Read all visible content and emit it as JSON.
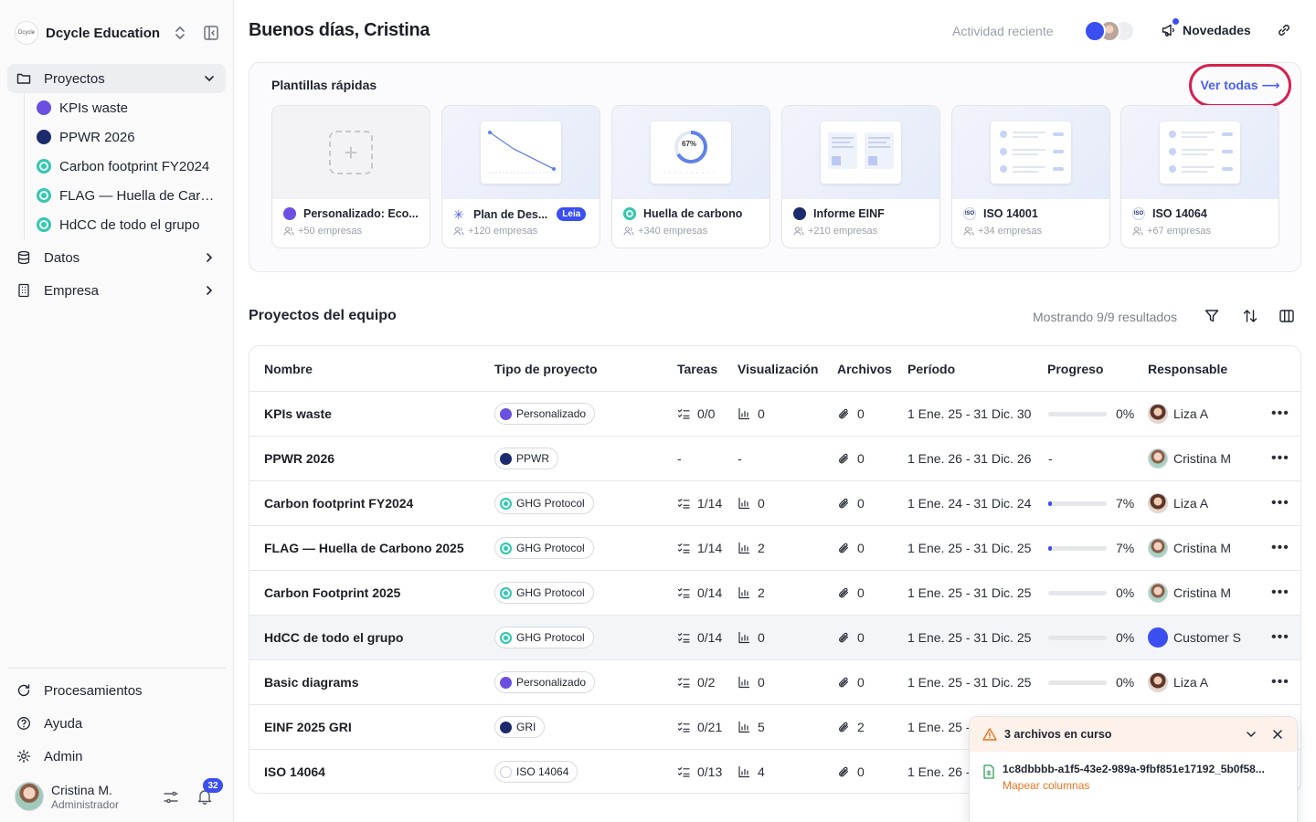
{
  "sidebar": {
    "org_name": "Dcycle Education",
    "org_logo_text": "Dcycle",
    "nav": [
      {
        "label": "Proyectos",
        "icon": "folder-icon"
      },
      {
        "label": "Datos",
        "icon": "database-icon"
      },
      {
        "label": "Empresa",
        "icon": "building-icon"
      }
    ],
    "projects": [
      {
        "label": "KPIs waste",
        "icon": "custom-icon"
      },
      {
        "label": "PPWR 2026",
        "icon": "eu-icon"
      },
      {
        "label": "Carbon footprint FY2024",
        "icon": "ghg-icon"
      },
      {
        "label": "FLAG — Huella de Carbono 2025",
        "icon": "ghg-icon"
      },
      {
        "label": "HdCC de todo el grupo",
        "icon": "ghg-icon"
      }
    ],
    "bottom": [
      {
        "label": "Procesamientos",
        "icon": "refresh-icon"
      },
      {
        "label": "Ayuda",
        "icon": "help-icon"
      },
      {
        "label": "Admin",
        "icon": "gear-icon"
      }
    ],
    "user": {
      "name": "Cristina M.",
      "role": "Administrador",
      "notifications": "32"
    }
  },
  "header": {
    "greeting": "Buenos días, Cristina",
    "recent_activity": "Actividad reciente",
    "news": "Novedades"
  },
  "templates": {
    "title": "Plantillas rápidas",
    "see_all": "Ver todas ⟶",
    "badge": "Leia",
    "items": [
      {
        "name": "Personalizado: Eco...",
        "companies": "+50 empresas",
        "icon": "custom-icon"
      },
      {
        "name": "Plan de Des...",
        "companies": "+120 empresas",
        "icon": "plan-icon"
      },
      {
        "name": "Huella de carbono",
        "companies": "+340 empresas",
        "icon": "ghg-icon"
      },
      {
        "name": "Informe EINF",
        "companies": "+210 empresas",
        "icon": "eu-icon"
      },
      {
        "name": "ISO 14001",
        "companies": "+34 empresas",
        "icon": "iso-icon"
      },
      {
        "name": "ISO 14064",
        "companies": "+67 empresas",
        "icon": "iso-icon"
      }
    ],
    "donut_label": "67%"
  },
  "team": {
    "title": "Proyectos del equipo",
    "showing": "Mostrando 9/9 resultados",
    "columns": [
      "Nombre",
      "Tipo de proyecto",
      "Tareas",
      "Visualización",
      "Archivos",
      "Período",
      "Progreso",
      "Responsable"
    ],
    "rows": [
      {
        "name": "KPIs waste",
        "type": "Personalizado",
        "type_icon": "custom-icon",
        "tasks": "0/0",
        "views": "0",
        "files": "0",
        "period": "1 Ene. 25 - 31 Dic. 30",
        "progress": 0,
        "progress_label": "0%",
        "owner": "Liza A",
        "owner_icon": "avatar-liza"
      },
      {
        "name": "PPWR 2026",
        "type": "PPWR",
        "type_icon": "eu-icon",
        "tasks": "-",
        "views": "-",
        "files": "0",
        "period": "1 Ene. 26 - 31 Dic. 26",
        "progress": null,
        "progress_label": "-",
        "owner": "Cristina M",
        "owner_icon": "avatar-cristina"
      },
      {
        "name": "Carbon footprint FY2024",
        "type": "GHG Protocol",
        "type_icon": "ghg-icon",
        "tasks": "1/14",
        "views": "0",
        "files": "0",
        "period": "1 Ene. 24 - 31 Dic. 24",
        "progress": 7,
        "progress_label": "7%",
        "owner": "Liza A",
        "owner_icon": "avatar-liza"
      },
      {
        "name": "FLAG — Huella de Carbono 2025",
        "type": "GHG Protocol",
        "type_icon": "ghg-icon",
        "tasks": "1/14",
        "views": "2",
        "files": "0",
        "period": "1 Ene. 25 - 31 Dic. 25",
        "progress": 7,
        "progress_label": "7%",
        "owner": "Cristina M",
        "owner_icon": "avatar-cristina"
      },
      {
        "name": "Carbon Footprint 2025",
        "type": "GHG Protocol",
        "type_icon": "ghg-icon",
        "tasks": "0/14",
        "views": "2",
        "files": "0",
        "period": "1 Ene. 25 - 31 Dic. 25",
        "progress": 0,
        "progress_label": "0%",
        "owner": "Cristina M",
        "owner_icon": "avatar-cristina"
      },
      {
        "name": "HdCC de todo el grupo",
        "type": "GHG Protocol",
        "type_icon": "ghg-icon",
        "tasks": "0/14",
        "views": "0",
        "files": "0",
        "period": "1 Ene. 25 - 31 Dic. 25",
        "progress": 0,
        "progress_label": "0%",
        "owner": "Customer S",
        "owner_icon": "avatar-dcycle"
      },
      {
        "name": "Basic diagrams",
        "type": "Personalizado",
        "type_icon": "custom-icon",
        "tasks": "0/2",
        "views": "0",
        "files": "0",
        "period": "1 Ene. 25 - 31 Dic. 25",
        "progress": 0,
        "progress_label": "0%",
        "owner": "Liza A",
        "owner_icon": "avatar-liza"
      },
      {
        "name": "EINF 2025 GRI",
        "type": "GRI",
        "type_icon": "eu-icon",
        "tasks": "0/21",
        "views": "5",
        "files": "2",
        "period": "1 Ene. 25 -",
        "progress": null,
        "progress_label": "",
        "owner": "",
        "owner_icon": ""
      },
      {
        "name": "ISO 14064",
        "type": "ISO 14064",
        "type_icon": "iso-icon",
        "tasks": "0/13",
        "views": "4",
        "files": "0",
        "period": "1 Ene. 26 -",
        "progress": null,
        "progress_label": "",
        "owner": "",
        "owner_icon": ""
      }
    ]
  },
  "toast": {
    "title": "3 archivos en curso",
    "file": "1c8dbbbb-a1f5-43e2-989a-9fbf851e17192_5b0f58...",
    "action": "Mapear columnas"
  },
  "colors": {
    "accent": "#3b4ff0",
    "highlight_ring": "#d6214f",
    "warning": "#e9741f"
  }
}
